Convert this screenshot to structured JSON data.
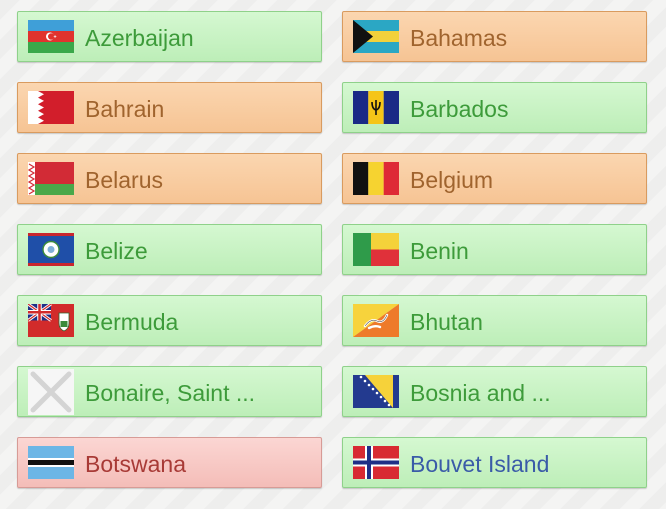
{
  "countries": [
    {
      "name": "Azerbaijan",
      "flag": "azerbaijan-flag-icon"
    },
    {
      "name": "Bahamas",
      "flag": "bahamas-flag-icon"
    },
    {
      "name": "Bahrain",
      "flag": "bahrain-flag-icon"
    },
    {
      "name": "Barbados",
      "flag": "barbados-flag-icon"
    },
    {
      "name": "Belarus",
      "flag": "belarus-flag-icon"
    },
    {
      "name": "Belgium",
      "flag": "belgium-flag-icon"
    },
    {
      "name": "Belize",
      "flag": "belize-flag-icon"
    },
    {
      "name": "Benin",
      "flag": "benin-flag-icon"
    },
    {
      "name": "Bermuda",
      "flag": "bermuda-flag-icon"
    },
    {
      "name": "Bhutan",
      "flag": "bhutan-flag-icon"
    },
    {
      "name": "Bonaire, Saint ...",
      "flag": "placeholder-x-icon"
    },
    {
      "name": "Bosnia and ...",
      "flag": "bosnia-flag-icon"
    },
    {
      "name": "Botswana",
      "flag": "botswana-flag-icon"
    },
    {
      "name": "Bouvet Island",
      "flag": "bouvet-island-flag-icon"
    }
  ],
  "colors": {
    "green_button": "#c8f4c4",
    "orange_button": "#f8cda1",
    "red_button": "#f7c6c2",
    "green_text": "#3d9b3a",
    "orange_text": "#a0642e",
    "red_text": "#a83a36",
    "blue_text": "#3a5ba8"
  }
}
